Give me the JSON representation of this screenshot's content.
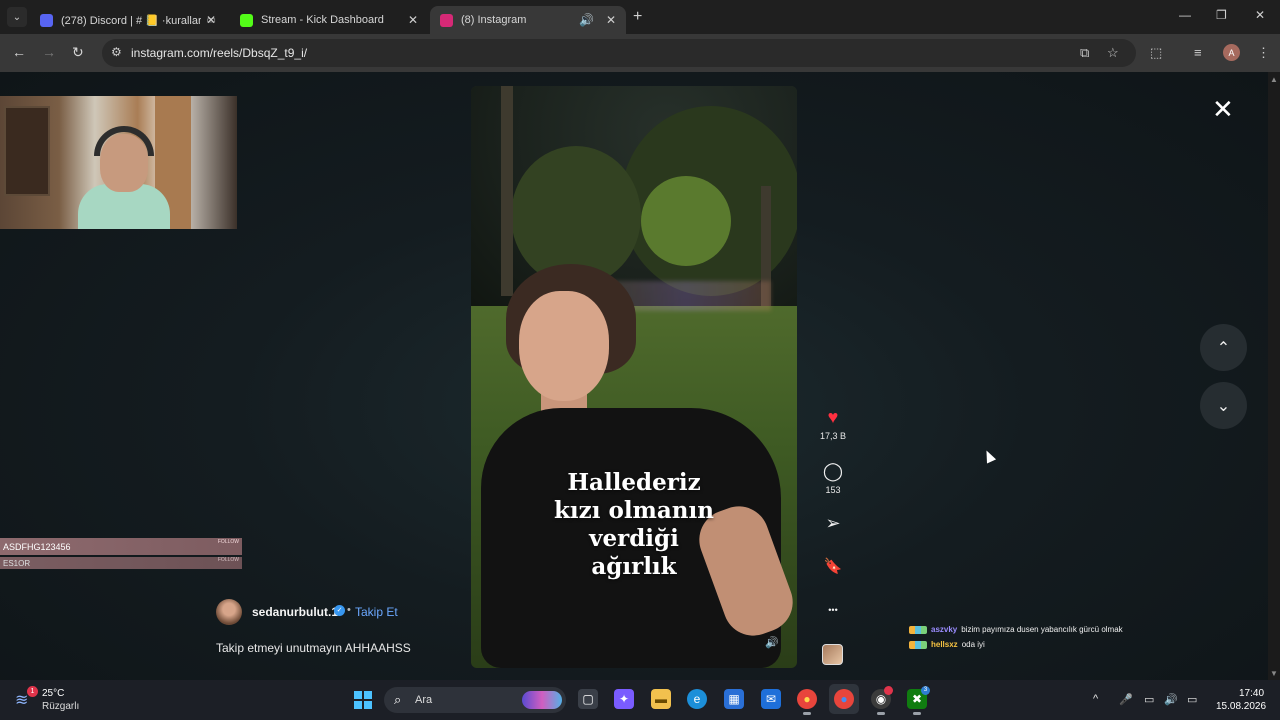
{
  "tabs": [
    {
      "label": "(278) Discord | # 📒 ·kurallar",
      "favicon_color": "#5865f2",
      "badge": "278",
      "close": "✕"
    },
    {
      "label": "Stream - Kick Dashboard",
      "favicon_color": "#53fc18",
      "close": "✕"
    },
    {
      "label": "(8) Instagram",
      "favicon_color": "#d62976",
      "audio": "🔊",
      "close": "✕"
    }
  ],
  "new_tab": "+",
  "window_controls": {
    "minimize": "—",
    "maximize": "❐",
    "close": "✕"
  },
  "toolbar": {
    "back": "←",
    "forward": "→",
    "reload": "↻",
    "site_info_icon": "⚙",
    "url": "instagram.com/reels/DbsqZ_t9_i/",
    "install_icon": "⧉",
    "star_icon": "☆",
    "extensions_icon": "⬚",
    "media_icon": "≡",
    "profile_initial": "A",
    "menu_icon": "⋮"
  },
  "stream_overlay": {
    "follow_primary": "ASDFHG123456",
    "follow_secondary": "ES1OR",
    "follow_tag": "FOLLOW"
  },
  "reel": {
    "caption_lines": [
      "Hallederiz",
      "kızı olmanın",
      "verdiği",
      "ağırlık"
    ],
    "mute_icon": "🔊"
  },
  "actions": {
    "like_icon": "♥",
    "like_count": "17,3 B",
    "comment_icon": "◯",
    "comment_count": "153",
    "share_icon": "➢",
    "save_icon": "🔖",
    "more_icon": "•••"
  },
  "author": {
    "username": "sedanurbulut.1",
    "verified_icon": "✓",
    "separator": "•",
    "follow_label": "Takip Et",
    "caption": "Takip etmeyi unutmayın AHHAAHSS"
  },
  "overlay_controls": {
    "close": "✕",
    "prev": "⌃",
    "next": "⌄"
  },
  "chat": [
    {
      "user": "aszvky",
      "user_color": "#9b8cff",
      "message": "bizim payımıza dusen yabancılık gürcü olmak"
    },
    {
      "user": "hellsxz",
      "user_color": "#f5c242",
      "message": "oda iyi"
    }
  ],
  "taskbar": {
    "weather_badge": "1",
    "temperature": "25°C",
    "condition": "Rüzgarlı",
    "search_placeholder": "Ara",
    "search_icon": "⌕",
    "apps": [
      {
        "name": "task-view",
        "glyph": "▢",
        "color": "#3a3f48"
      },
      {
        "name": "copilot",
        "glyph": "✦",
        "color": "#7a5cff"
      },
      {
        "name": "file-explorer",
        "glyph": "▬",
        "color": "#f2c14e"
      },
      {
        "name": "edge",
        "glyph": "e",
        "color": "#1c8fd9"
      },
      {
        "name": "store",
        "glyph": "▦",
        "color": "#2a6fd6"
      },
      {
        "name": "outlook",
        "glyph": "✉",
        "color": "#1e6fd9"
      },
      {
        "name": "chrome",
        "glyph": "●",
        "color": "#e8453c"
      },
      {
        "name": "chrome-active",
        "glyph": "●",
        "color": "#e8453c"
      },
      {
        "name": "obs",
        "glyph": "◉",
        "color": "#3b3b3b"
      },
      {
        "name": "xbox",
        "glyph": "✖",
        "color": "#107c10"
      }
    ],
    "xbox_badge": "3",
    "tray": {
      "chevron": "^",
      "mic": "🎤",
      "network": "▭",
      "volume": "🔊",
      "battery": "▭"
    },
    "time": "17:40",
    "date": "15.08.2026"
  }
}
